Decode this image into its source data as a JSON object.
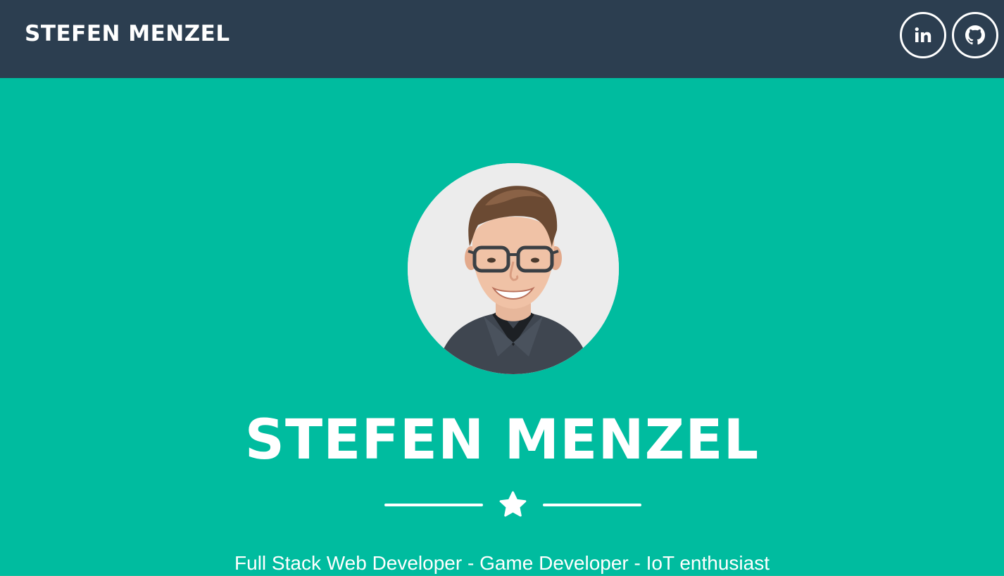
{
  "navbar": {
    "brand": "STEFEN MENZEL",
    "social": [
      {
        "icon": "linkedin-icon",
        "label": "in"
      },
      {
        "icon": "github-icon"
      }
    ]
  },
  "hero": {
    "avatar_icon": "profile-photo",
    "title": "STEFEN MENZEL",
    "divider_icon": "star-icon",
    "subtitle": "Full Stack Web Developer - Game Developer - IoT enthusiast"
  },
  "colors": {
    "navbar_bg": "#2c3e50",
    "hero_bg": "#00bc9f",
    "text": "#ffffff"
  }
}
